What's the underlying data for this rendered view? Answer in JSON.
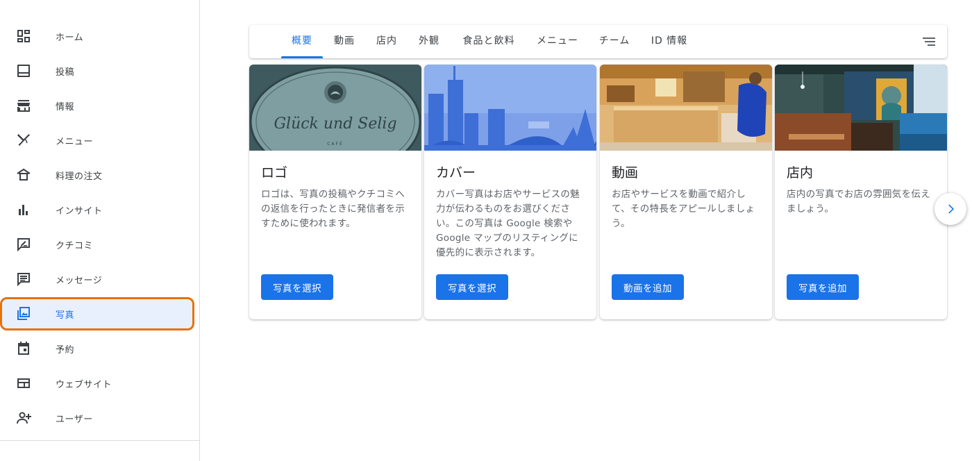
{
  "sidebar": {
    "items": [
      {
        "label": "ホーム",
        "icon": "dashboard-icon"
      },
      {
        "label": "投稿",
        "icon": "posts-icon"
      },
      {
        "label": "情報",
        "icon": "store-icon"
      },
      {
        "label": "メニュー",
        "icon": "utensils-icon"
      },
      {
        "label": "料理の注文",
        "icon": "food-order-icon"
      },
      {
        "label": "インサイト",
        "icon": "bar-chart-icon"
      },
      {
        "label": "クチコミ",
        "icon": "review-icon"
      },
      {
        "label": "メッセージ",
        "icon": "message-icon"
      },
      {
        "label": "写真",
        "icon": "photo-library-icon"
      },
      {
        "label": "予約",
        "icon": "calendar-icon"
      },
      {
        "label": "ウェブサイト",
        "icon": "website-icon"
      },
      {
        "label": "ユーザー",
        "icon": "add-user-icon"
      }
    ],
    "active_index": 8
  },
  "tabs": {
    "items": [
      "概要",
      "動画",
      "店内",
      "外観",
      "食品と飲料",
      "メニュー",
      "チーム",
      "ID 情報"
    ],
    "active_index": 0
  },
  "cards": [
    {
      "title": "ロゴ",
      "description": "ロゴは、写真の投稿やクチコミへの返信を行ったときに発信者を示すために使われます。",
      "button": "写真を選択",
      "logo_text": "Glück und Selig",
      "logo_sub": "CAFÉ"
    },
    {
      "title": "カバー",
      "description": "カバー写真はお店やサービスの魅力が伝わるものをお選びください。この写真は Google 検索や Google マップのリスティングに優先的に表示されます。",
      "button": "写真を選択"
    },
    {
      "title": "動画",
      "description": "お店やサービスを動画で紹介して、その特長をアピールしましょう。",
      "button": "動画を追加"
    },
    {
      "title": "店内",
      "description": "店内の写真でお店の雰囲気を伝えましょう。",
      "button": "写真を追加"
    }
  ],
  "colors": {
    "accent": "#1a73e8",
    "highlight_border": "#e8710a",
    "active_bg": "#e8f0fe"
  }
}
